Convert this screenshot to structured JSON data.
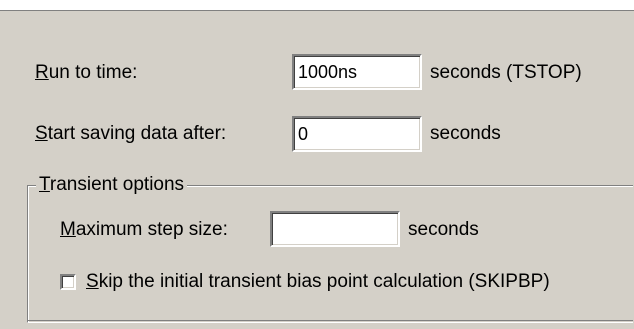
{
  "run_to_time": {
    "label_hotkey": "R",
    "label_rest": "un to time:",
    "value": "1000ns",
    "units": "seconds  (TSTOP)"
  },
  "start_saving": {
    "label_hotkey": "S",
    "label_rest": "tart saving data after:",
    "value": "0",
    "units": "seconds"
  },
  "transient_options": {
    "title_hotkey": "T",
    "title_rest": "ransient options",
    "max_step": {
      "label_hotkey": "M",
      "label_rest": "aximum step size:",
      "value": "",
      "units": "seconds"
    },
    "skip_bias": {
      "label_hotkey": "S",
      "label_rest": "kip the initial transient bias point calculation  (SKIPBP)",
      "checked": false
    }
  }
}
